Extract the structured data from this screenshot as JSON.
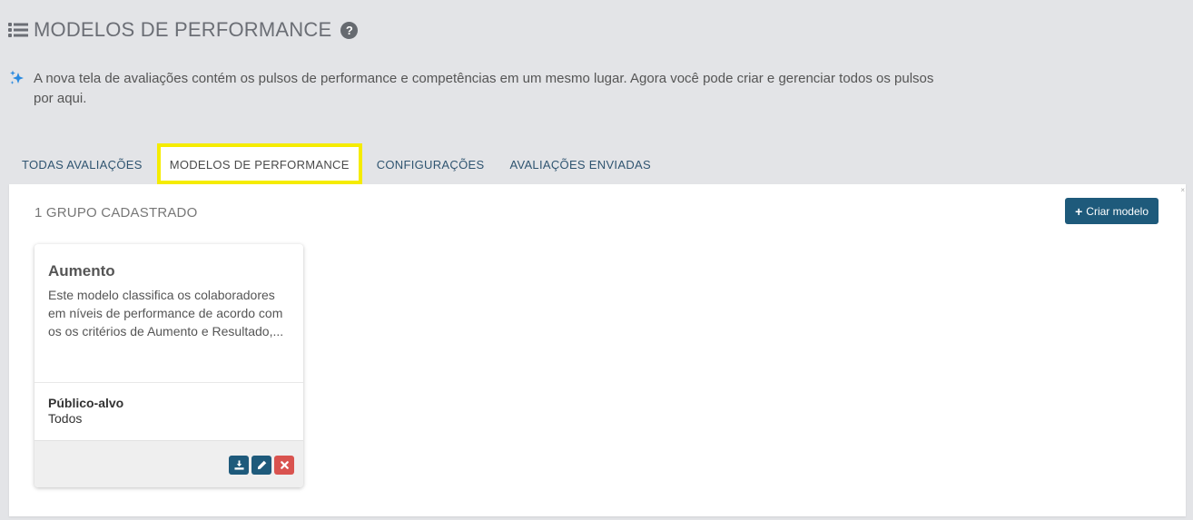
{
  "header": {
    "title": "MODELOS DE PERFORMANCE",
    "help_symbol": "?",
    "icon": "list-icon"
  },
  "notice": {
    "icon": "sparkle-icon",
    "text": "A nova tela de avaliações contém os pulsos de performance e competências em um mesmo lugar. Agora você pode criar e gerenciar todos os pulsos por aqui."
  },
  "tabs": [
    {
      "label": "TODAS AVALIAÇÕES",
      "active": false
    },
    {
      "label": "MODELOS DE PERFORMANCE",
      "active": true
    },
    {
      "label": "CONFIGURAÇÕES",
      "active": false
    },
    {
      "label": "AVALIAÇÕES ENVIADAS",
      "active": false
    }
  ],
  "panel": {
    "count_label": "1 GRUPO CADASTRADO",
    "create_button": {
      "icon": "plus-icon",
      "plus": "+",
      "label": "Criar modelo"
    },
    "corner_mark": "×"
  },
  "cards": [
    {
      "title": "Aumento",
      "description": "Este modelo classifica os colaboradores em níveis de performance de acordo com os os critérios de Aumento e Resultado,...",
      "audience_label": "Público-alvo",
      "audience_value": "Todos",
      "actions": [
        "download-icon",
        "edit-icon",
        "delete-icon"
      ]
    }
  ],
  "colors": {
    "background": "#e3e4e7",
    "primary": "#1e5a7b",
    "danger": "#d9534f",
    "highlight": "#f5ec00",
    "sparkle": "#2a8ae0"
  }
}
